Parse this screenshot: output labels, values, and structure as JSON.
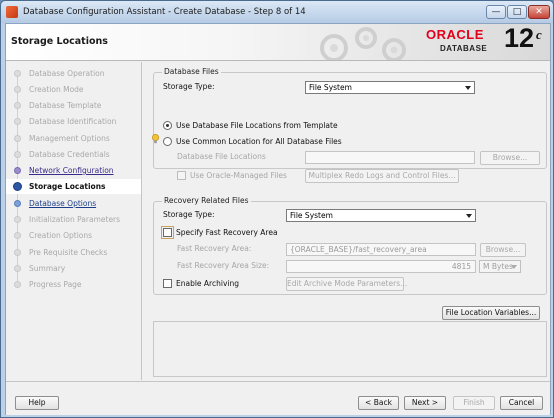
{
  "window": {
    "title": "Database Configuration Assistant - Create Database - Step 8 of 14",
    "min_glyph": "—",
    "max_glyph": "□",
    "close_glyph": "✕"
  },
  "header": {
    "page_title": "Storage Locations",
    "logo_oracle": "ORACLE",
    "logo_database": "DATABASE",
    "logo_version": "12",
    "logo_version_suffix": "c"
  },
  "nav": {
    "items": [
      {
        "label": "Database Operation",
        "state": "disabled"
      },
      {
        "label": "Creation Mode",
        "state": "disabled"
      },
      {
        "label": "Database Template",
        "state": "disabled"
      },
      {
        "label": "Database Identification",
        "state": "disabled"
      },
      {
        "label": "Management Options",
        "state": "disabled"
      },
      {
        "label": "Database Credentials",
        "state": "disabled"
      },
      {
        "label": "Network Configuration",
        "state": "done"
      },
      {
        "label": "Storage Locations",
        "state": "current"
      },
      {
        "label": "Database Options",
        "state": "next"
      },
      {
        "label": "Initialization Parameters",
        "state": "disabled"
      },
      {
        "label": "Creation Options",
        "state": "disabled"
      },
      {
        "label": "Pre Requisite Checks",
        "state": "disabled"
      },
      {
        "label": "Summary",
        "state": "disabled"
      },
      {
        "label": "Progress Page",
        "state": "disabled"
      }
    ]
  },
  "database_files": {
    "legend": "Database Files",
    "storage_type_label": "Storage Type:",
    "storage_type_value": "File System",
    "radio_template_label": "Use Database File Locations from Template",
    "radio_common_label": "Use Common Location for All Database Files",
    "file_locations_label": "Database File Locations",
    "file_locations_value": "",
    "browse_label": "Browse...",
    "omf_label": "Use Oracle-Managed Files",
    "multiplex_label": "Multiplex Redo Logs and Control Files..."
  },
  "recovery_files": {
    "legend": "Recovery Related Files",
    "storage_type_label": "Storage Type:",
    "storage_type_value": "File System",
    "specify_fra_label": "Specify Fast Recovery Area",
    "fra_label": "Fast Recovery Area:",
    "fra_value": "{ORACLE_BASE}/fast_recovery_area",
    "browse_label": "Browse...",
    "fra_size_label": "Fast Recovery Area Size:",
    "fra_size_value": "4815",
    "fra_size_unit": "M Bytes",
    "archiving_label": "Enable Archiving",
    "archive_params_label": "Edit Archive Mode Parameters..."
  },
  "file_location_variables_label": "File Location Variables...",
  "buttons": {
    "help": "Help",
    "back": "< Back",
    "next": "Next >",
    "finish": "Finish",
    "cancel": "Cancel"
  }
}
